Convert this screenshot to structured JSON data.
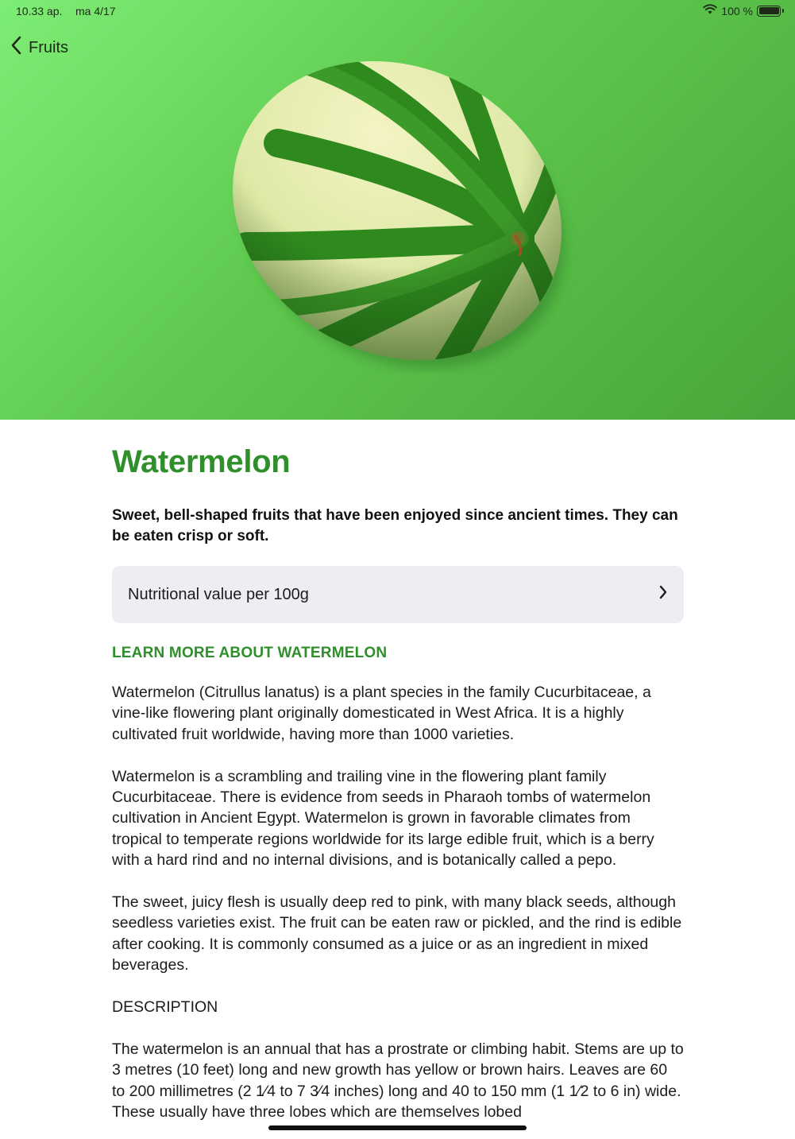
{
  "status_bar": {
    "time": "10.33 ap.",
    "date": "ma 4/17",
    "battery": "100 %"
  },
  "nav": {
    "back_label": "Fruits"
  },
  "fruit": {
    "title": "Watermelon",
    "headline": "Sweet, bell-shaped fruits that have been enjoyed since ancient times. They can be eaten crisp or soft.",
    "nutrition_label": "Nutritional value per 100g",
    "learn_more_heading": "LEARN MORE ABOUT WATERMELON",
    "paragraphs": [
      "Watermelon (Citrullus lanatus) is a plant species in the family Cucurbitaceae, a vine-like flowering plant originally domesticated in West Africa. It is a highly cultivated fruit worldwide, having more than 1000 varieties.",
      "Watermelon is a scrambling and trailing vine in the flowering plant family Cucurbitaceae. There is evidence from seeds in Pharaoh tombs of watermelon cultivation in Ancient Egypt. Watermelon is grown in favorable climates from tropical to temperate regions worldwide for its large edible fruit, which is a berry with a hard rind and no internal divisions, and is botanically called a pepo.",
      "The sweet, juicy flesh is usually deep red to pink, with many black seeds, although seedless varieties exist. The fruit can be eaten raw or pickled, and the rind is edible after cooking. It is commonly consumed as a juice or as an ingredient in mixed beverages."
    ],
    "description_label": "DESCRIPTION",
    "description_text": "The watermelon is an annual that has a prostrate or climbing habit. Stems are up to 3 metres (10 feet) long and new growth has yellow or brown hairs. Leaves are 60 to 200 millimetres (2 1⁄4 to 7 3⁄4 inches) long and 40 to 150 mm (1 1⁄2 to 6 in) wide. These usually have three lobes which are themselves lobed"
  },
  "colors": {
    "accent_green": "#2f8f2a",
    "hero_gradient_start": "#7eed75",
    "hero_gradient_end": "#47a638",
    "row_background": "#eeeef2"
  },
  "icons": {
    "back": "chevron-left-icon",
    "wifi": "wifi-icon",
    "battery": "battery-icon",
    "disclosure": "chevron-right-icon"
  }
}
